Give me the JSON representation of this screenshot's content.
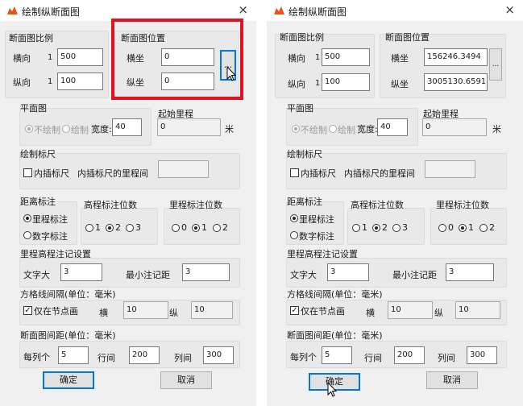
{
  "dialog": {
    "title": "绘制纵断面图",
    "close_symbol": "×",
    "accent_logo": "#e8541a",
    "highlight_color": "#e0141e"
  },
  "scale": {
    "title": "断面图比例",
    "h_label": "横向",
    "v_label": "纵向",
    "prefix": "1",
    "h_value": "500",
    "v_value": "100"
  },
  "position": {
    "title": "断面图位置",
    "x_label": "横坐",
    "y_label": "纵坐",
    "browse_label": "..."
  },
  "left_state": {
    "x_value": "0",
    "y_value": "0"
  },
  "right_state": {
    "x_value": "156246.3494",
    "y_value": "3005130.6591"
  },
  "plan": {
    "title": "平面图",
    "opt_none": "不绘制",
    "opt_draw": "绘制",
    "width_label": "宽度:",
    "width_value": "40"
  },
  "mileage_start": {
    "title": "起始里程",
    "value": "0",
    "unit": "米"
  },
  "ruler": {
    "title": "绘制标尺",
    "interp_label": "内插标尺",
    "interval_label": "内插标尺的里程间",
    "interval_value": ""
  },
  "distance": {
    "title": "距离标注",
    "opt_mileage": "里程标注",
    "opt_number": "数字标注"
  },
  "elev_digits": {
    "title": "高程标注位数",
    "opts": [
      "1",
      "2",
      "3"
    ]
  },
  "mile_digits": {
    "title": "里程标注位数",
    "opts": [
      "0",
      "1",
      "2"
    ]
  },
  "annot": {
    "title": "里程高程注记设置",
    "text_size_label": "文字大",
    "text_size_value": "3",
    "min_dist_label": "最小注记距",
    "min_dist_value": "3"
  },
  "grid": {
    "title": "方格线间隔(单位：毫米)",
    "only_nodes_label": "仅在节点画",
    "h_label": "横",
    "h_value": "10",
    "v_label": "纵",
    "v_value": "10"
  },
  "spacing": {
    "title": "断面图间距(单位：毫米)",
    "per_col_label": "每列个",
    "per_col_value": "5",
    "row_label": "行间",
    "row_value": "200",
    "col_label": "列间",
    "col_value": "300"
  },
  "actions": {
    "ok_label": "确定",
    "cancel_label": "取消"
  }
}
